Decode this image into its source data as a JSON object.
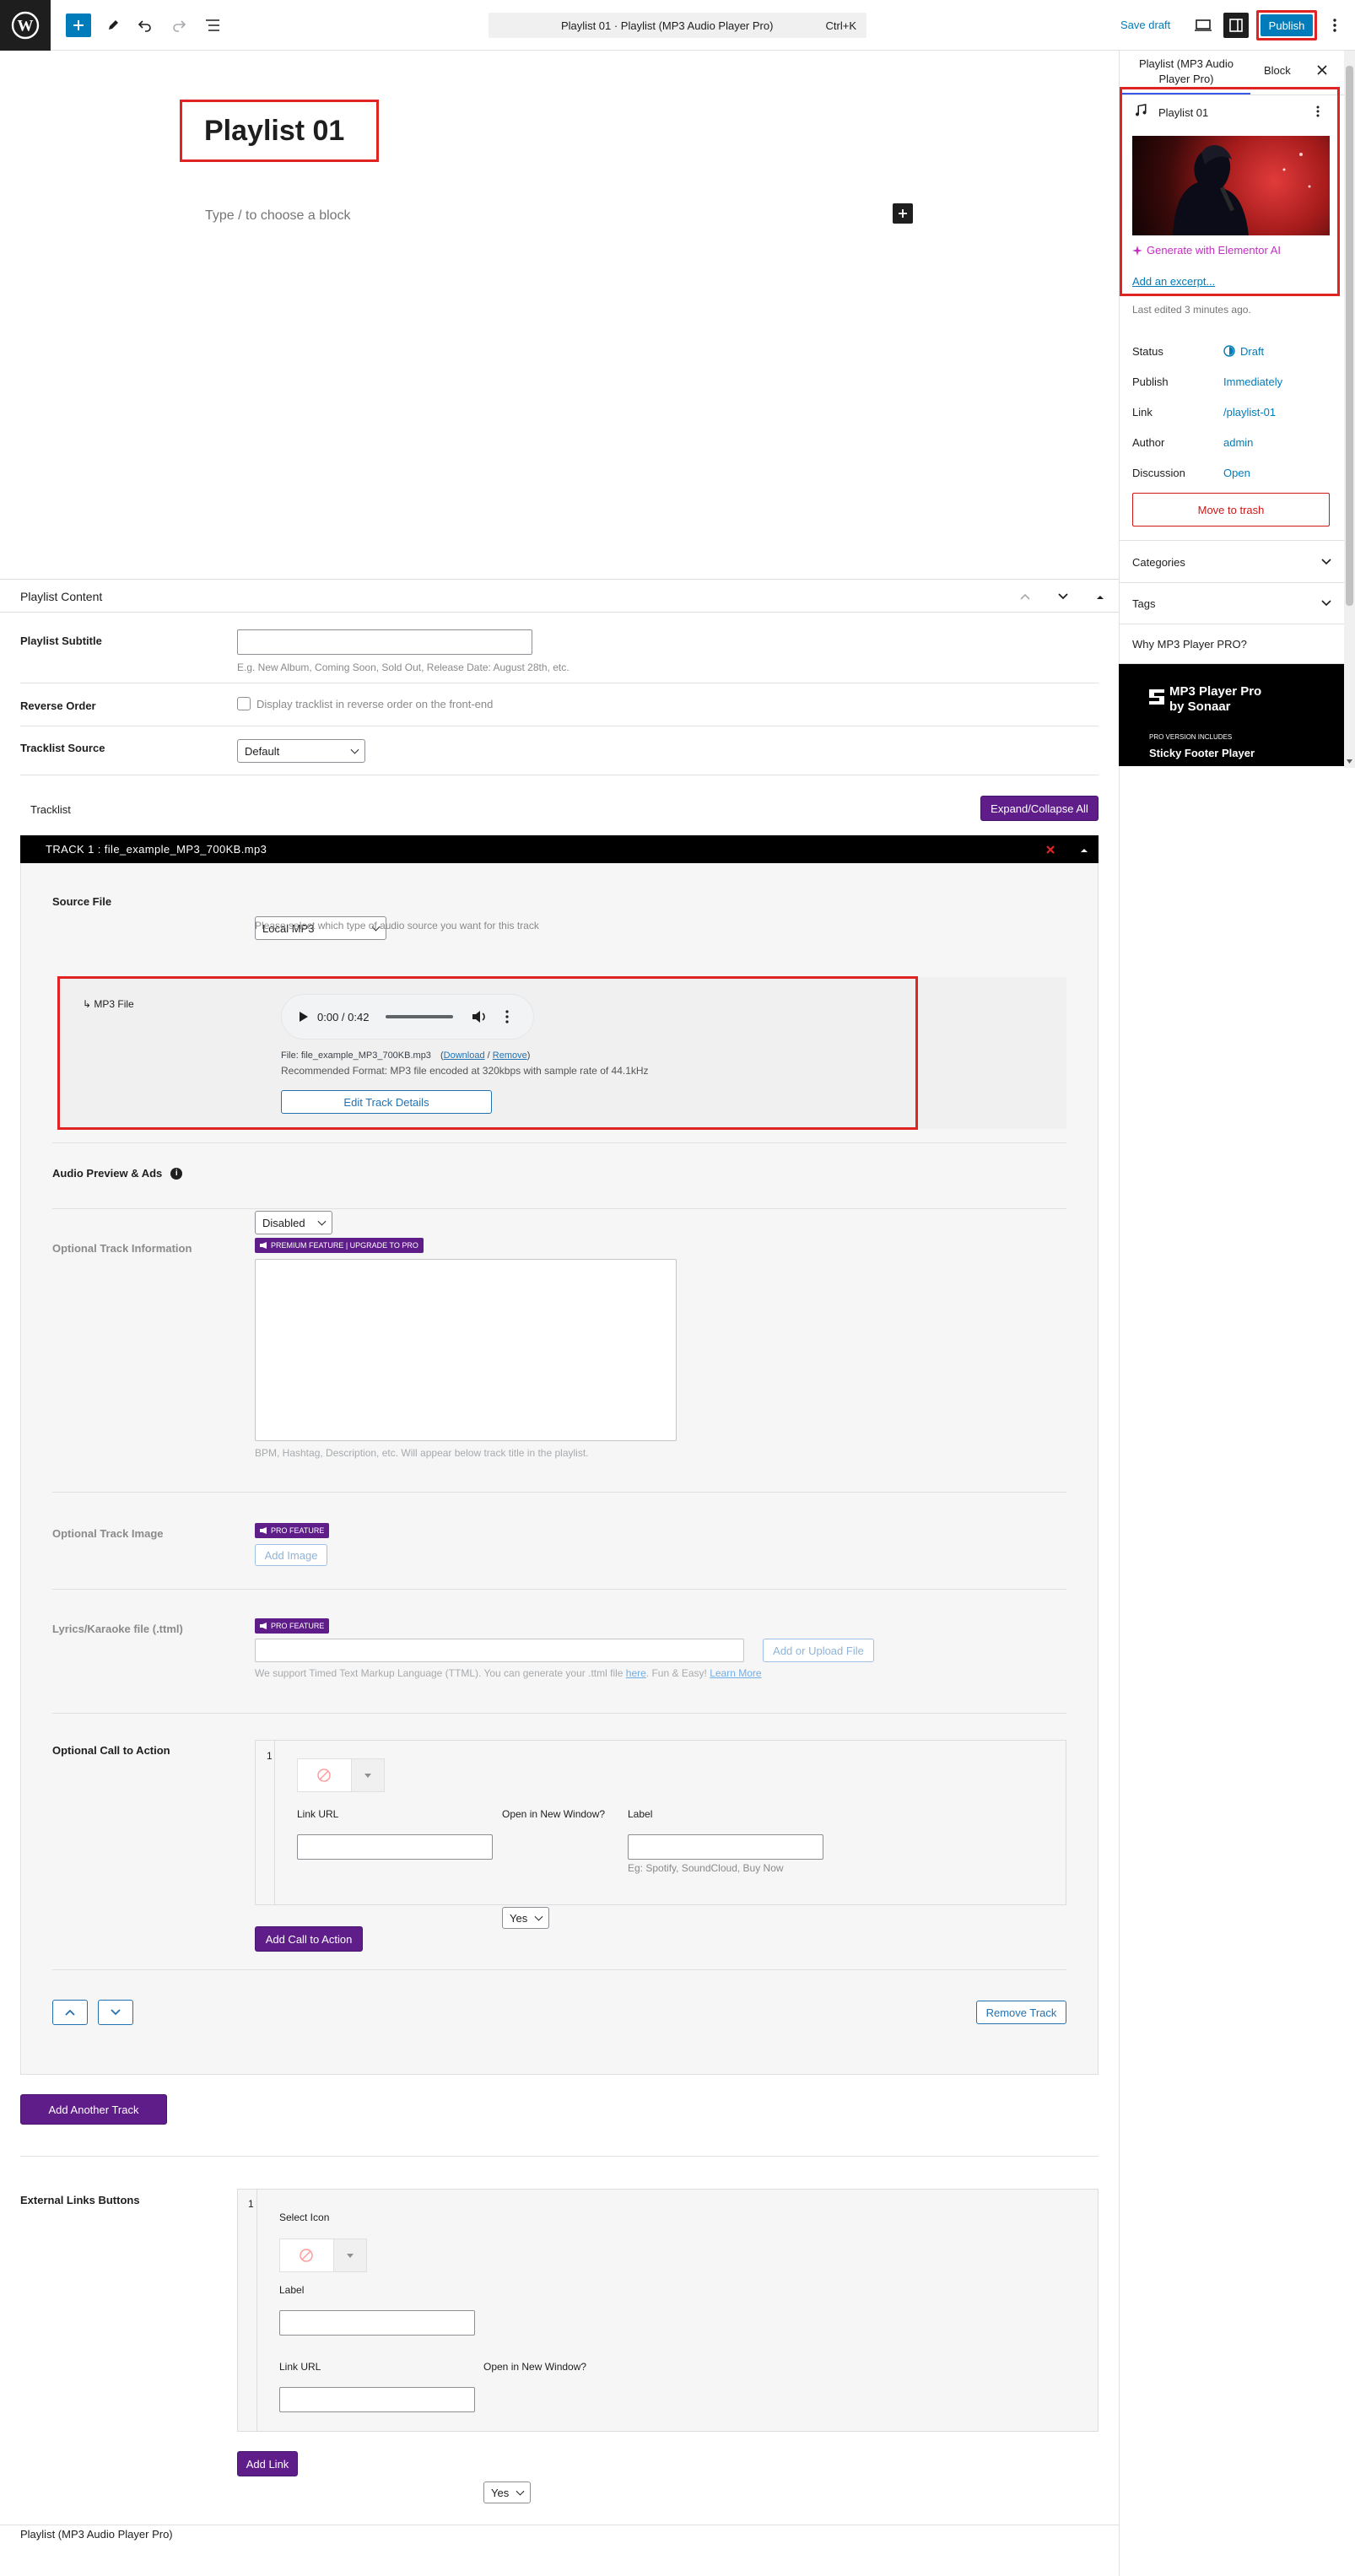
{
  "topbar": {
    "doc_title": "Playlist 01 · Playlist (MP3 Audio Player Pro)",
    "shortcut": "Ctrl+K",
    "save_draft": "Save draft",
    "publish": "Publish"
  },
  "editor": {
    "post_title": "Playlist 01",
    "block_placeholder": "Type / to choose a block"
  },
  "sidebar": {
    "tab_post": "Playlist (MP3 Audio Player Pro)",
    "tab_block": "Block",
    "post_name": "Playlist 01",
    "generate_ai": "Generate with Elementor AI",
    "add_excerpt": "Add an excerpt...",
    "last_edited": "Last edited 3 minutes ago.",
    "rows": [
      {
        "label": "Status",
        "value": "Draft"
      },
      {
        "label": "Publish",
        "value": "Immediately"
      },
      {
        "label": "Link",
        "value": "/playlist-01"
      },
      {
        "label": "Author",
        "value": "admin"
      },
      {
        "label": "Discussion",
        "value": "Open"
      }
    ],
    "move_trash": "Move to trash",
    "categories": "Categories",
    "tags": "Tags",
    "why_pro": "Why MP3 Player PRO?",
    "promo": {
      "brand_line1": "MP3 Player Pro",
      "brand_line2": "by Sonaar",
      "includes": "PRO VERSION INCLUDES",
      "feature": "Sticky Footer Player"
    }
  },
  "metabox": {
    "title": "Playlist Content",
    "subtitle_label": "Playlist Subtitle",
    "subtitle_help": "E.g. New Album, Coming Soon, Sold Out, Release Date: August 28th, etc.",
    "reverse_label": "Reverse Order",
    "reverse_help": "Display tracklist in reverse order on the front-end",
    "source_label": "Tracklist Source",
    "source_value": "Default",
    "tracklist_label": "Tracklist",
    "expand_all": "Expand/Collapse All",
    "track": {
      "header": "TRACK 1 : file_example_MP3_700KB.mp3",
      "source_label": "Source File",
      "source_value": "Local MP3",
      "source_help": "Please select which type of audio source you want for this track",
      "mp3_label": "↳ MP3 File",
      "player_time": "0:00 / 0:42",
      "file_prefix": "File: file_example_MP3_700KB.mp3",
      "file_download": "Download",
      "file_remove": "Remove",
      "recommended": "Recommended Format: MP3 file encoded at 320kbps with sample rate of 44.1kHz",
      "edit_details": "Edit Track Details",
      "preview_label": "Audio Preview & Ads",
      "preview_value": "Disabled",
      "info_label": "Optional Track Information",
      "premium_badge": "PREMIUM FEATURE | UPGRADE TO PRO",
      "info_help": "BPM, Hashtag, Description, etc. Will appear below track title in the playlist.",
      "image_label": "Optional Track Image",
      "pro_badge": "PRO FEATURE",
      "add_image": "Add Image",
      "lyrics_label": "Lyrics/Karaoke file (.ttml)",
      "lyrics_badge": "PRO FEATURE",
      "upload_file": "Add or Upload File",
      "lyrics_help_pre": "We support Timed Text Markup Language (TTML). You can generate your .ttml file ",
      "lyrics_here": "here",
      "lyrics_mid": ". Fun & Easy! ",
      "lyrics_learn": "Learn More",
      "cta_label": "Optional Call to Action",
      "cta_index": "1",
      "cta_link_url": "Link URL",
      "cta_new_window": "Open in New Window?",
      "cta_new_window_value": "Yes",
      "cta_label_field": "Label",
      "cta_label_help": "Eg: Spotify, SoundCloud, Buy Now",
      "add_cta": "Add Call to Action",
      "remove_track": "Remove Track"
    },
    "add_track": "Add Another Track",
    "ext_label": "External Links Buttons",
    "ext_index": "1",
    "ext_select_icon": "Select Icon",
    "ext_label_field": "Label",
    "ext_link_url": "Link URL",
    "ext_new_window": "Open in New Window?",
    "ext_new_window_value": "Yes",
    "add_link": "Add Link"
  },
  "footer": {
    "breadcrumb": "Playlist (MP3 Audio Player Pro)"
  },
  "colors": {
    "wp_blue": "#3858e9",
    "primary": "#007cba",
    "purple": "#5f1d8a",
    "danger": "#cc1818",
    "highlight": "#e02424",
    "ai_pink": "#c32ec3"
  }
}
